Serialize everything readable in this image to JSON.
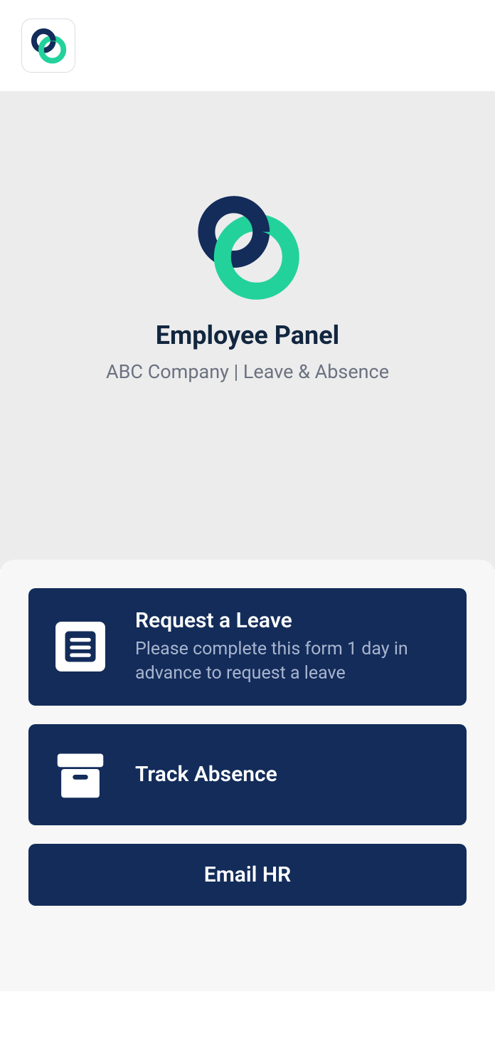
{
  "brand": {
    "colors": {
      "navy": "#132c5a",
      "green": "#23d29b"
    }
  },
  "hero": {
    "title": "Employee Panel",
    "subtitle": "ABC Company | Leave & Absence"
  },
  "actions": {
    "request_leave": {
      "title": "Request a Leave",
      "description": "Please complete this form 1 day in advance to request a leave"
    },
    "track_absence": {
      "title": "Track Absence"
    },
    "email_hr": {
      "label": "Email HR"
    }
  }
}
